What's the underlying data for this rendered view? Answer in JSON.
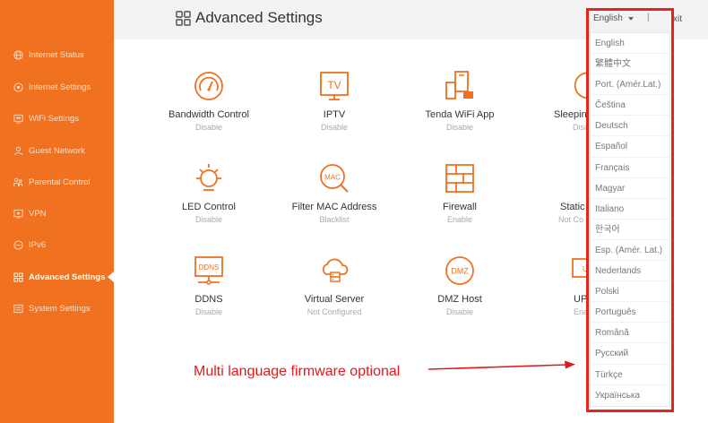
{
  "sidebar": {
    "items": [
      {
        "label": "Internet Status",
        "icon": "globe-icon"
      },
      {
        "label": "Internet Settings",
        "icon": "network-icon"
      },
      {
        "label": "WiFi Settings",
        "icon": "monitor-icon"
      },
      {
        "label": "Guest Network",
        "icon": "user-icon"
      },
      {
        "label": "Parental Control",
        "icon": "family-icon"
      },
      {
        "label": "VPN",
        "icon": "vpn-icon"
      },
      {
        "label": "IPv6",
        "icon": "ipv6-icon"
      },
      {
        "label": "Advanced Settings",
        "icon": "grid-icon",
        "active": true
      },
      {
        "label": "System Settings",
        "icon": "settings-icon"
      }
    ]
  },
  "header": {
    "title": "Advanced Settings",
    "language": "English",
    "divider": "|",
    "exit_label": "xit"
  },
  "features": [
    {
      "name": "Bandwidth Control",
      "status": "Disable",
      "icon": "gauge-icon"
    },
    {
      "name": "IPTV",
      "status": "Disable",
      "icon": "tv-icon"
    },
    {
      "name": "Tenda WiFi App",
      "status": "Disable",
      "icon": "app-icon"
    },
    {
      "name": "Sleeping",
      "status": "Disa",
      "icon": "sleep-icon"
    },
    {
      "name": "LED Control",
      "status": "Disable",
      "icon": "bulb-icon"
    },
    {
      "name": "Filter MAC Address",
      "status": "Blacklist",
      "icon": "mac-filter-icon"
    },
    {
      "name": "Firewall",
      "status": "Enable",
      "icon": "firewall-icon"
    },
    {
      "name": "Static",
      "status": "Not Co",
      "icon": "static-route-icon"
    },
    {
      "name": "DDNS",
      "status": "Disable",
      "icon": "ddns-icon"
    },
    {
      "name": "Virtual Server",
      "status": "Not Configured",
      "icon": "server-icon"
    },
    {
      "name": "DMZ Host",
      "status": "Disable",
      "icon": "dmz-icon"
    },
    {
      "name": "UP",
      "status": "Ena",
      "icon": "upnp-icon"
    }
  ],
  "languages": [
    "English",
    "繁體中文",
    "Port. (Amér.Lat.)",
    "Čeština",
    "Deutsch",
    "Español",
    "Français",
    "Magyar",
    "Italiano",
    "한국어",
    "Esp. (Amér. Lat.)",
    "Nederlands",
    "Polski",
    "Português",
    "Română",
    "Русский",
    "Türkçe",
    "Українська"
  ],
  "annotation": "Multi language firmware optional",
  "colors": {
    "accent": "#f0711f",
    "highlight": "#e8231b"
  }
}
